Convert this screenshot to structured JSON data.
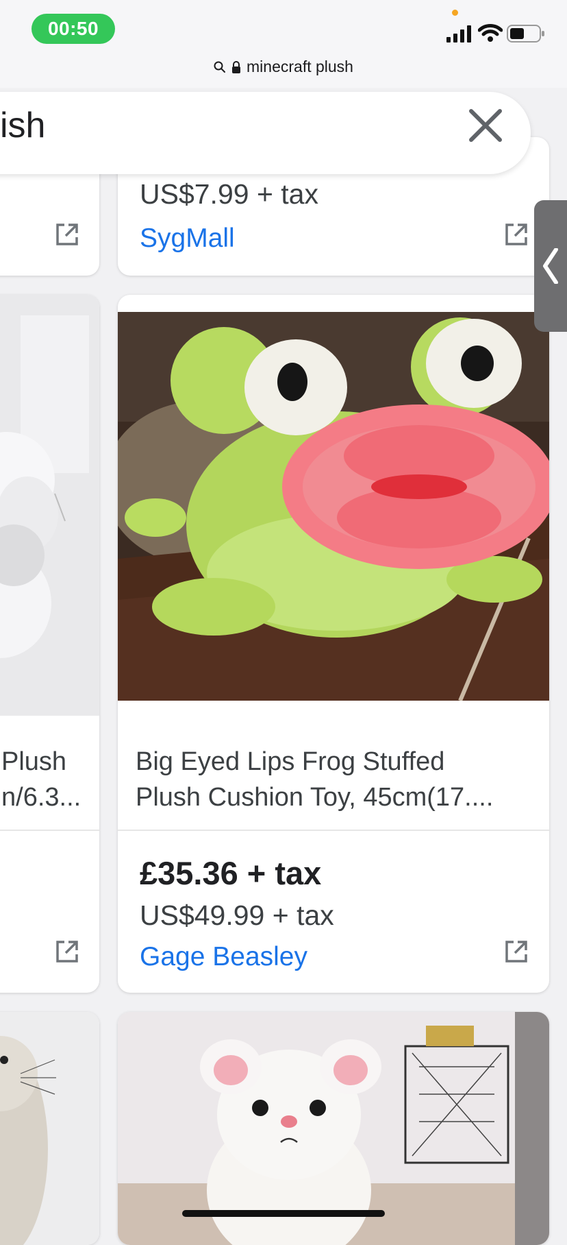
{
  "status_bar": {
    "time": "00:50",
    "url": "minecraft plush"
  },
  "search": {
    "query": "ish"
  },
  "cards": {
    "left_top": {},
    "right_top": {
      "usd_price": "US$7.99 + tax",
      "store": "SygMall"
    },
    "left_middle": {
      "title_line1": "Plush",
      "title_line2": "n/6.3..."
    },
    "right_middle": {
      "title_line1": "Big Eyed Lips Frog Stuffed",
      "title_line2": "Plush Cushion Toy, 45cm(17....",
      "gbp_price": "£35.36 + tax",
      "usd_price": "US$49.99 + tax",
      "store": "Gage Beasley"
    }
  },
  "icons": {
    "search": "search-icon",
    "lock": "lock-icon",
    "close": "close-icon",
    "external_link": "external-link-icon",
    "signal": "cellular-signal-icon",
    "wifi": "wifi-icon",
    "battery": "battery-icon",
    "chevron": "chevron-left-icon"
  },
  "colors": {
    "time_pill": "#34c759",
    "store_link": "#1a73e8",
    "privacy_dot": "#f5a623"
  }
}
